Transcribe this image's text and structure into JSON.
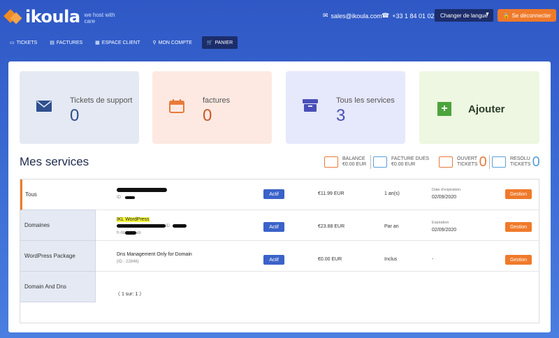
{
  "header": {
    "brand": "ikoula",
    "tagline": "we host with care",
    "email": "sales@ikoula.com",
    "phone": "+33 1 84 01 02 50",
    "language_label": "Changer de langue",
    "logout_label": "Se déconnecter"
  },
  "nav": [
    {
      "label": "TICKETS",
      "icon": "ticket-icon"
    },
    {
      "label": "FACTURES",
      "icon": "invoice-icon"
    },
    {
      "label": "ESPACE CLIENT",
      "icon": "dashboard-icon"
    },
    {
      "label": "MON COMPTE",
      "icon": "user-icon"
    },
    {
      "label": "PANIER",
      "icon": "cart-icon",
      "active": true
    }
  ],
  "cards": {
    "tickets": {
      "label": "Tickets de support",
      "value": "0",
      "color": "#2f4f8f"
    },
    "factures": {
      "label": "factures",
      "value": "0",
      "color": "#e87a3a"
    },
    "services": {
      "label": "Tous les services",
      "value": "3",
      "color": "#4a4fb8"
    },
    "add": {
      "label": "Ajouter",
      "color": "#4ba43c"
    }
  },
  "section_title": "Mes services",
  "stats": {
    "balance": {
      "label": "BALANCE",
      "value": "€0.00 EUR"
    },
    "facture_dues": {
      "label": "FACTURE DUES",
      "value": "€0.00 EUR"
    },
    "ouvert": {
      "label": "OUVERT",
      "label2": "TICKETS",
      "value": "0"
    },
    "resolu": {
      "label": "RESOLU",
      "label2": "TICKETS",
      "value": "0"
    }
  },
  "tabs": [
    "Tous",
    "Domaines",
    "WordPress Package",
    "Domain And Dns"
  ],
  "rows": [
    {
      "name": "",
      "sub": "ID",
      "status": "Actif",
      "price": "€11.99 EUR",
      "period": "1 an(s)",
      "exp_label": "Date d'expiration",
      "exp_date": "02/09/2020",
      "action": "Gestion"
    },
    {
      "name": "IKL WordPress",
      "sub": "ID",
      "sub2": "fr-hb",
      "sub3": "eb",
      "status": "Actif",
      "price": "€23.88 EUR",
      "period": "Par an",
      "exp_label": "Expiration",
      "exp_date": "02/09/2020",
      "action": "Gestion"
    },
    {
      "name": "Dns Management Only for Domain",
      "sub": "(ID : 22846)",
      "status": "Actif",
      "price": "€0.00 EUR",
      "period": "Inclus",
      "exp_date": "-",
      "action": "Gestion"
    }
  ],
  "pager": "〈 1 sur: 1 〉"
}
